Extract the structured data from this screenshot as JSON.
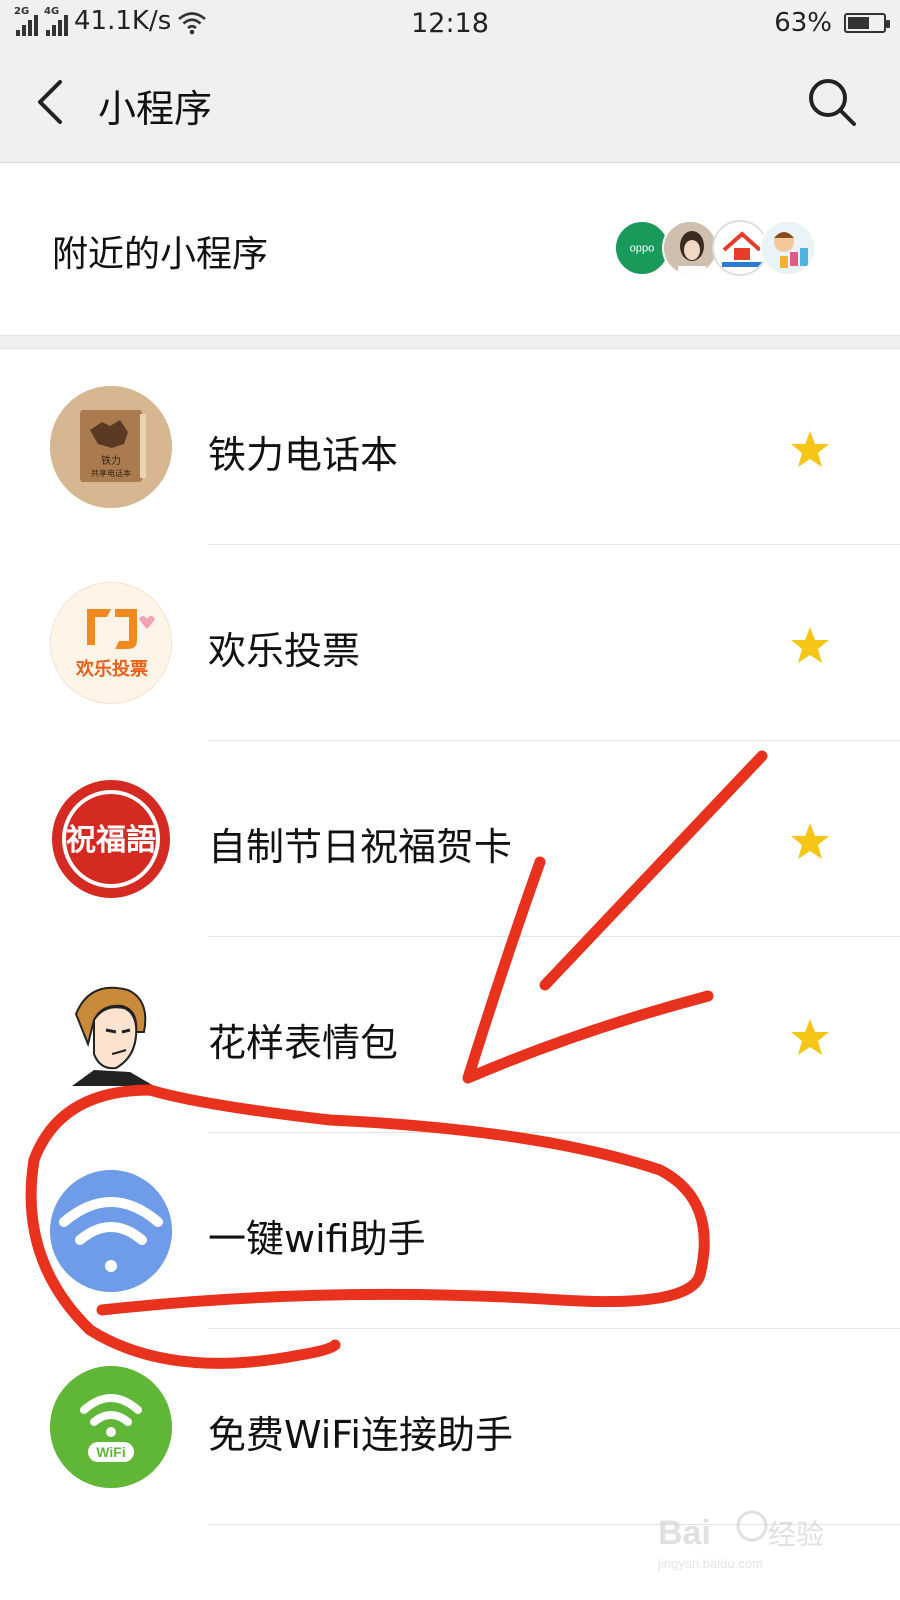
{
  "status_bar": {
    "network": "41.1K/s",
    "time": "12:18",
    "battery": "63%",
    "battery_level": 0.63
  },
  "header": {
    "title": "小程序"
  },
  "nearby": {
    "label": "附近的小程序"
  },
  "list": [
    {
      "name": "铁力电话本",
      "starred": true
    },
    {
      "name": "欢乐投票",
      "starred": true
    },
    {
      "name": "自制节日祝福贺卡",
      "starred": true
    },
    {
      "name": "花样表情包",
      "starred": true
    },
    {
      "name": "一键wifi助手",
      "starred": false
    },
    {
      "name": "免费WiFi连接助手",
      "starred": false
    }
  ],
  "colors": {
    "star": "#f5c518",
    "annotation": "#e8321e"
  }
}
